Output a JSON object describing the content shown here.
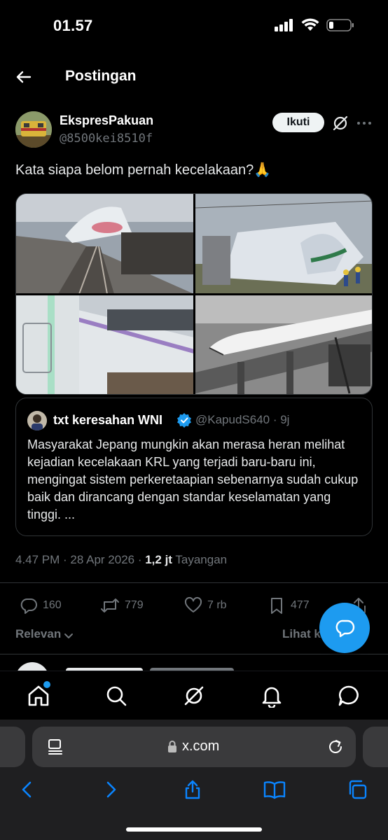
{
  "status": {
    "time": "01.57"
  },
  "header": {
    "title": "Postingan"
  },
  "author": {
    "name": "EkspresPakuan",
    "handle": "@8500kei8510f",
    "follow_label": "Ikuti"
  },
  "post": {
    "text": "Kata siapa belom pernah kecelakaan?🙏"
  },
  "quote": {
    "name": "txt keresahan WNI",
    "handle_time": "@KapudS640 · 9j",
    "text": "Masyarakat Jepang mungkin akan merasa heran melihat kejadian kecelakaan KRL yang terjadi baru-baru ini, mengingat sistem perkeretaapian sebenarnya sudah cukup baik dan dirancang dengan standar keselamatan yang tinggi. ..."
  },
  "meta": {
    "time_date": "4.47 PM · 28 Apr 2026 · ",
    "views": "1,2 jt",
    "views_label": " Tayangan"
  },
  "actions": {
    "replies": "160",
    "reposts": "779",
    "likes": "7 rb",
    "bookmarks": "477"
  },
  "replies_header": {
    "sort_label": "Relevan",
    "view_quotes": "Lihat k"
  },
  "browser": {
    "url": "x.com"
  },
  "colors": {
    "accent": "#1d9bf0",
    "background": "#000000",
    "muted": "#71767b"
  }
}
